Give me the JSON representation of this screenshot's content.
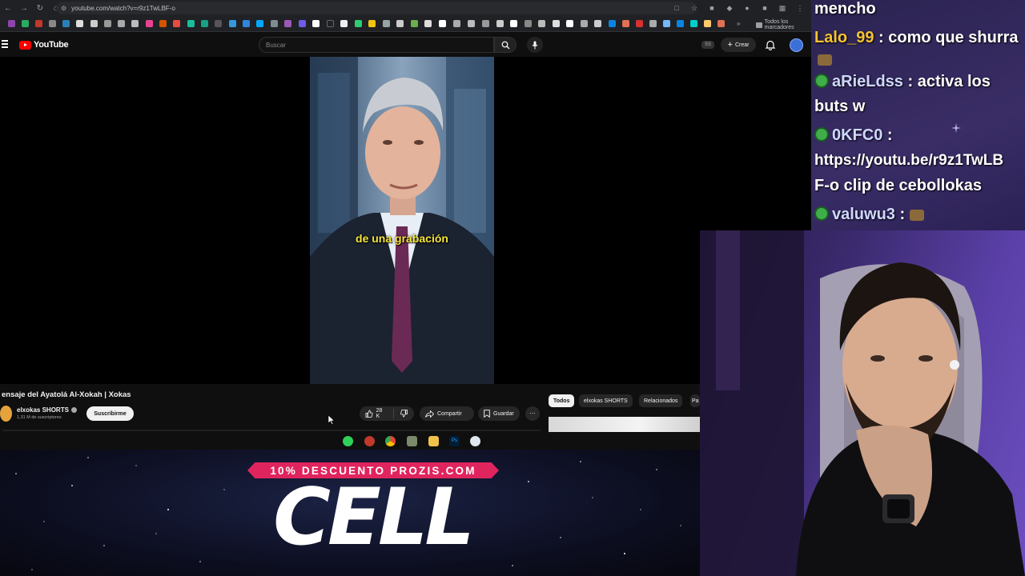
{
  "browser": {
    "url": "youtube.com/watch?v=r9z1TwLBF-o",
    "bookmarks_folder": "Todos los marcadores"
  },
  "youtube": {
    "logo_text": "YouTube",
    "search_placeholder": "Buscar",
    "cast_label": "SS",
    "create_label": "Crear"
  },
  "video": {
    "caption": "de una grabación",
    "title": "ensaje del Ayatolá Al-Xokah | Xokas",
    "channel_name": "elxokas SHORTS",
    "subscribers": "1,31 M de suscriptores",
    "subscribe_label": "Suscribirme",
    "likes": "28 K",
    "share_label": "Compartir",
    "save_label": "Guardar"
  },
  "chips": {
    "all": "Todos",
    "channel": "elxokas SHORTS",
    "related": "Relacionados",
    "more": "Pa"
  },
  "banner": {
    "promo": "10% DESCUENTO PROZIS.COM",
    "brand": "CELL"
  },
  "chat": {
    "messages": [
      {
        "user": "",
        "text": "mencho"
      },
      {
        "user": "Lalo_99",
        "text": ": como que shurra"
      },
      {
        "user": "aRieLdss",
        "text": ": activa los"
      },
      {
        "user": "",
        "text": "buts w"
      },
      {
        "user": "0KFC0",
        "text": ":"
      },
      {
        "user": "",
        "text": "https://youtu.be/r9z1TwLB"
      },
      {
        "user": "",
        "text": "F-o clip de cebollokas"
      },
      {
        "user": "valuwu3",
        "text": ":"
      }
    ]
  },
  "colors": {
    "yt_red": "#ff0000",
    "promo_pink": "#e0245e",
    "caption_yellow": "#f5e63a",
    "chat_gold": "#f4c430"
  }
}
